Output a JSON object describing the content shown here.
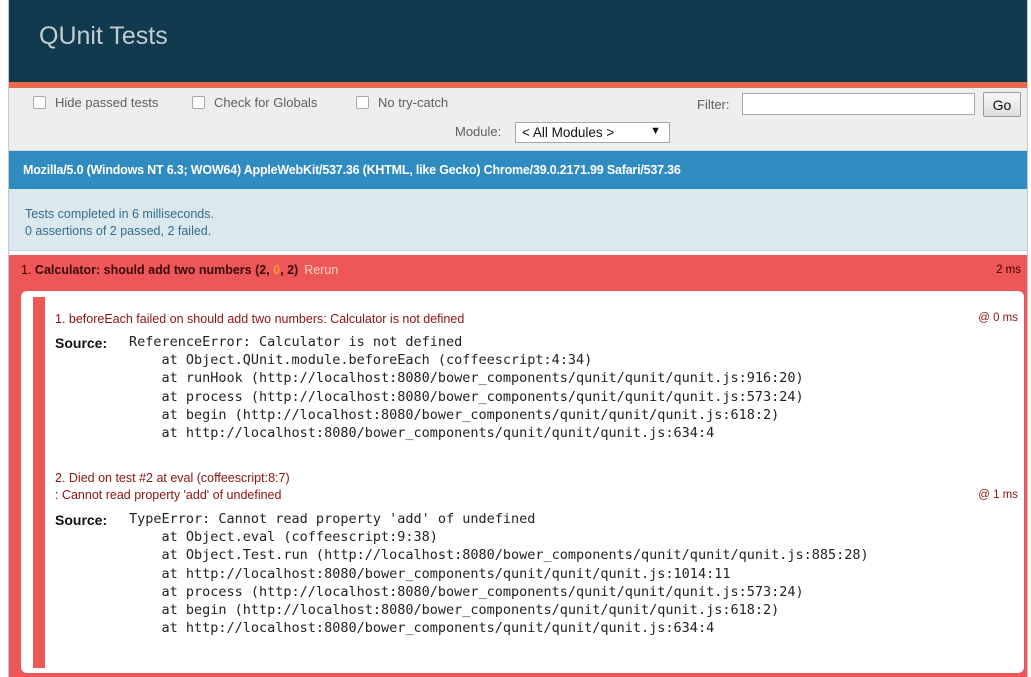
{
  "header": {
    "title": "QUnit Tests"
  },
  "toolbar": {
    "hide_passed": "Hide passed tests",
    "check_globals": "Check for Globals",
    "no_try_catch": "No try-catch",
    "filter_label": "Filter:",
    "filter_value": "",
    "go_label": "Go",
    "module_label": "Module:",
    "module_selected": "< All Modules >"
  },
  "user_agent": "Mozilla/5.0 (Windows NT 6.3; WOW64) AppleWebKit/537.36 (KHTML, like Gecko) Chrome/39.0.2171.99 Safari/537.36",
  "result": {
    "line1": "Tests completed in 6 milliseconds.",
    "line2": "0 assertions of 2 passed, 2 failed."
  },
  "test": {
    "index": "1.",
    "name": "Calculator: should add two numbers",
    "failed": "2",
    "passed": "0",
    "total": "2",
    "rerun": "Rerun",
    "time": "2 ms",
    "colors": {
      "failed_bg": "#ee5757",
      "header_bg": "#123a4f",
      "ua_bg": "#2f8bc0"
    },
    "assertions": [
      {
        "message": "1. beforeEach failed on should add two numbers: Calculator is not defined",
        "time": "@ 0 ms",
        "source_label": "Source:",
        "source": "ReferenceError: Calculator is not defined\n    at Object.QUnit.module.beforeEach (coffeescript:4:34)\n    at runHook (http://localhost:8080/bower_components/qunit/qunit/qunit.js:916:20)\n    at process (http://localhost:8080/bower_components/qunit/qunit/qunit.js:573:24)\n    at begin (http://localhost:8080/bower_components/qunit/qunit/qunit.js:618:2)\n    at http://localhost:8080/bower_components/qunit/qunit/qunit.js:634:4"
      },
      {
        "message": "2. Died on test #2   at eval (coffeescript:8:7)",
        "message2": ": Cannot read property 'add' of undefined",
        "time": "@ 1 ms",
        "source_label": "Source:",
        "source": "TypeError: Cannot read property 'add' of undefined\n    at Object.eval (coffeescript:9:38)\n    at Object.Test.run (http://localhost:8080/bower_components/qunit/qunit/qunit.js:885:28)\n    at http://localhost:8080/bower_components/qunit/qunit/qunit.js:1014:11\n    at process (http://localhost:8080/bower_components/qunit/qunit/qunit.js:573:24)\n    at begin (http://localhost:8080/bower_components/qunit/qunit/qunit.js:618:2)\n    at http://localhost:8080/bower_components/qunit/qunit/qunit.js:634:4"
      }
    ]
  }
}
